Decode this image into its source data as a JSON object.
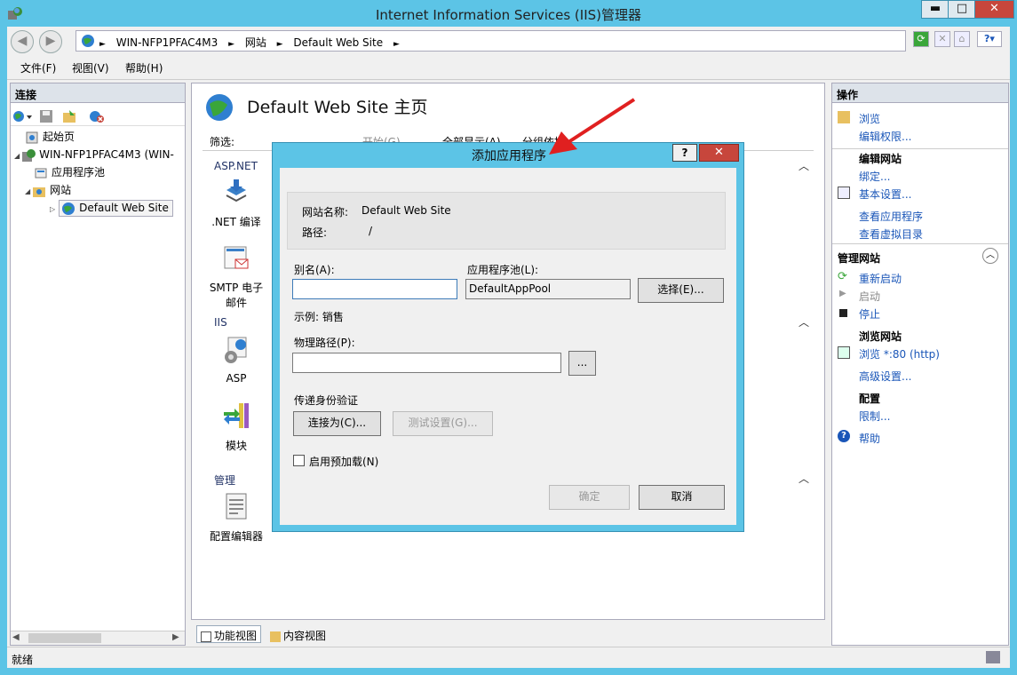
{
  "window": {
    "title": "Internet Information Services (IIS)管理器",
    "minimize": "▬",
    "maximize": "□",
    "close": "✕"
  },
  "address": {
    "segments": [
      "WIN-NFP1PFAC4M3",
      "网站",
      "Default Web Site"
    ],
    "separator": "►"
  },
  "menu": {
    "file": "文件(F)",
    "view": "视图(V)",
    "help": "帮助(H)"
  },
  "connections": {
    "header": "连接",
    "tree": [
      {
        "label": "起始页"
      },
      {
        "label": "WIN-NFP1PFAC4M3 (WIN-"
      },
      {
        "label": "应用程序池"
      },
      {
        "label": "网站"
      },
      {
        "label": "Default Web Site"
      }
    ]
  },
  "center": {
    "page_title": "Default Web Site 主页",
    "filter_label": "筛选:",
    "filter_go": "开始(G)",
    "filter_showall": "全部显示(A)",
    "filter_groupby": "分组依据:",
    "groups": {
      "aspnet": "ASP.NET",
      "iis": "IIS",
      "manage": "管理"
    },
    "features": {
      "net_compile": ".NET 编译",
      "smtp": "SMTP 电子\n邮件",
      "asp": "ASP",
      "modules": "模块",
      "config_editor": "配置编辑器"
    },
    "tabs": {
      "features_view": "功能视图",
      "content_view": "内容视图"
    }
  },
  "actions": {
    "header": "操作",
    "browse": "浏览",
    "edit_perms": "编辑权限...",
    "edit_site": "编辑网站",
    "bindings": "绑定...",
    "basic_settings": "基本设置...",
    "view_apps": "查看应用程序",
    "view_vdirs": "查看虚拟目录",
    "manage_site": "管理网站",
    "restart": "重新启动",
    "start": "启动",
    "stop": "停止",
    "browse_site": "浏览网站",
    "browse_80": "浏览 *:80 (http)",
    "advanced": "高级设置...",
    "config": "配置",
    "limits": "限制...",
    "help": "帮助"
  },
  "status": {
    "text": "就绪"
  },
  "dialog": {
    "title": "添加应用程序",
    "help_btn": "?",
    "close_btn": "✕",
    "site_name_label": "网站名称:",
    "site_name_value": "Default Web Site",
    "path_label": "路径:",
    "path_value": "/",
    "alias_label": "别名(A):",
    "alias_value": "",
    "pool_label": "应用程序池(L):",
    "pool_value": "DefaultAppPool",
    "select_btn": "选择(E)...",
    "example": "示例: 销售",
    "physical_label": "物理路径(P):",
    "physical_value": "",
    "browse_btn": "...",
    "auth_label": "传递身份验证",
    "connect_as_btn": "连接为(C)...",
    "test_btn": "测试设置(G)...",
    "preload_label": "启用预加载(N)",
    "ok_btn": "确定",
    "cancel_btn": "取消"
  },
  "colors": {
    "frame": "#5cc4e6",
    "close_red": "#c7463c",
    "link_blue": "#1a56b8",
    "arrow_red": "#e02020"
  }
}
